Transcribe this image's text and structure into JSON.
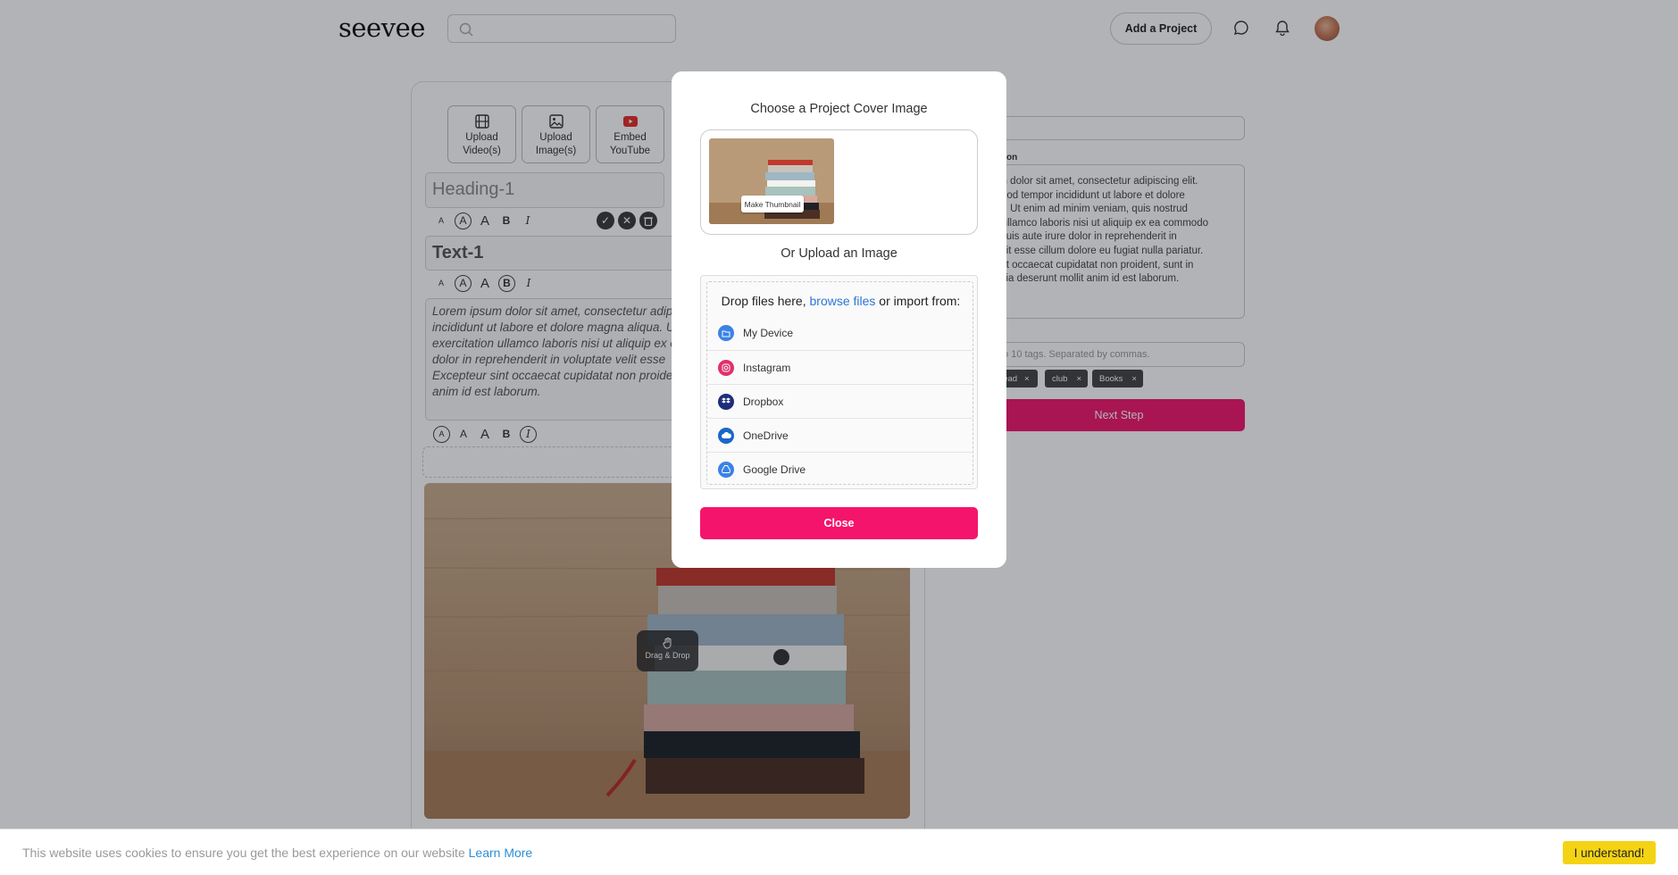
{
  "header": {
    "logo": "seevee",
    "search_placeholder": "",
    "add_project_label": "Add a Project",
    "chat_icon": "chat-bubble-icon",
    "bell_icon": "bell-icon"
  },
  "editor": {
    "tools": [
      {
        "label": "Upload\nVideo(s)",
        "icon": "film-icon"
      },
      {
        "label": "Upload\nImage(s)",
        "icon": "image-icon"
      },
      {
        "label": "Embed\nYouTube",
        "icon": "youtube-icon"
      }
    ],
    "heading_text": "Heading-1",
    "text_block": "Text-1",
    "lorem": "Lorem ipsum dolor sit amet, consectetur adip\nincididunt ut labore et dolore magna aliqua. U\nexercitation ullamco laboris nisi ut aliquip ex e\ndolor in reprehenderit in voluptate velit esse \nExcepteur sint occaecat cupidatat non proide\nanim id est laborum.",
    "format_glyphs": [
      "A",
      "A",
      "A",
      "B",
      "I"
    ],
    "drag_drop_label": "Drag & Drop"
  },
  "form": {
    "description_label": "iption",
    "description_text": "um dolor sit amet, consectetur adipiscing elit.\nsmod tempor incididunt ut labore et dolore\nua. Ut enim ad minim veniam, quis nostrud\nn ullamco laboris nisi ut aliquip ex ea commodo\n. Duis aute irure dolor in reprehenderit in\nvelit esse cillum dolore eu fugiat nulla pariatur.\nsint occaecat cupidatat non proident, sunt in\nfficia deserunt mollit anim id est laborum.",
    "tags_label": "ct",
    "tags_placeholder": "to 10 tags. Separated by commas.",
    "tags": [
      "read",
      "club",
      "Books"
    ],
    "tag_remove": "×",
    "next_step_label": "Next Step"
  },
  "modal": {
    "title": "Choose a Project Cover Image",
    "make_thumbnail_label": "Make Thumbnail",
    "or_upload_label": "Or Upload an Image",
    "drop_prefix": "Drop files here, ",
    "browse_link": "browse files",
    "drop_suffix": " or import from:",
    "sources": [
      {
        "label": "My Device",
        "icon": "folder-icon",
        "color": "#3b82e6"
      },
      {
        "label": "Instagram",
        "icon": "instagram-icon",
        "color": "#e1306c"
      },
      {
        "label": "Dropbox",
        "icon": "dropbox-icon",
        "color": "#1d2d7a"
      },
      {
        "label": "OneDrive",
        "icon": "cloud-icon",
        "color": "#1a66c8"
      },
      {
        "label": "Google Drive",
        "icon": "google-drive-icon",
        "color": "#3b82e6"
      }
    ],
    "close_label": "Close"
  },
  "cookie": {
    "message": "This website uses cookies to ensure you get the best experience on our website ",
    "learn_more": "Learn More",
    "accept_label": "I understand!"
  },
  "colors": {
    "accent": "#f5146b",
    "link": "#2b76d6",
    "cookie_button": "#f4d315"
  }
}
